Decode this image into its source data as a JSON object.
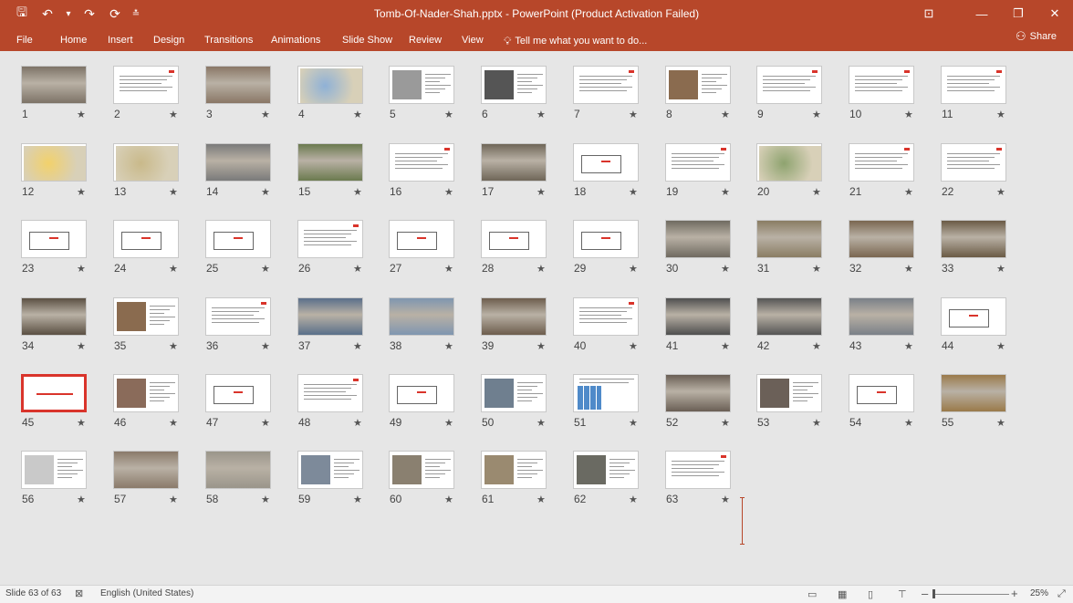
{
  "titlebar": {
    "title": "Tomb-Of-Nader-Shah.pptx - PowerPoint (Product Activation Failed)",
    "quick_access": [
      {
        "name": "save-icon",
        "glyph": "🖫"
      },
      {
        "name": "undo-icon",
        "glyph": "↶"
      },
      {
        "name": "undo-dropdown-icon",
        "glyph": "▾"
      },
      {
        "name": "redo-icon",
        "glyph": "↷"
      },
      {
        "name": "start-from-beginning-icon",
        "glyph": "⟳"
      },
      {
        "name": "customize-qat-icon",
        "glyph": "≛"
      }
    ],
    "window_controls": [
      {
        "name": "ribbon-display-options-icon",
        "glyph": "⊡"
      },
      {
        "name": "minimize-icon",
        "glyph": "—"
      },
      {
        "name": "restore-icon",
        "glyph": "❐"
      },
      {
        "name": "close-icon",
        "glyph": "✕"
      }
    ]
  },
  "ribbon": {
    "tabs": [
      "File",
      "Home",
      "Insert",
      "Design",
      "Transitions",
      "Animations",
      "Slide Show",
      "Review",
      "View"
    ],
    "tell_me": "Tell me what you want to do...",
    "tell_me_icon": "lightbulb-icon",
    "share": "Share",
    "share_icon": "person-icon"
  },
  "slides": {
    "count": 63,
    "transition_marker": "★",
    "selected": 63,
    "items": [
      {
        "n": "1",
        "kind": "photo",
        "tone": "#7d7367"
      },
      {
        "n": "2",
        "kind": "text",
        "tone": "#ffffff"
      },
      {
        "n": "3",
        "kind": "photo",
        "tone": "#8a7766"
      },
      {
        "n": "4",
        "kind": "map",
        "tone": "#8fb1d6"
      },
      {
        "n": "5",
        "kind": "photo-text",
        "tone": "#9a9a9a"
      },
      {
        "n": "6",
        "kind": "photo-text",
        "tone": "#555555"
      },
      {
        "n": "7",
        "kind": "text",
        "tone": "#ffffff"
      },
      {
        "n": "8",
        "kind": "photo-text",
        "tone": "#8a6b4f"
      },
      {
        "n": "9",
        "kind": "text",
        "tone": "#ffffff"
      },
      {
        "n": "10",
        "kind": "text",
        "tone": "#ffffff"
      },
      {
        "n": "11",
        "kind": "text",
        "tone": "#ffffff"
      },
      {
        "n": "12",
        "kind": "map",
        "tone": "#f2d16b"
      },
      {
        "n": "13",
        "kind": "map",
        "tone": "#c9b98a"
      },
      {
        "n": "14",
        "kind": "photo",
        "tone": "#7a7a7a"
      },
      {
        "n": "15",
        "kind": "photo",
        "tone": "#6b7a4f"
      },
      {
        "n": "16",
        "kind": "text",
        "tone": "#ffffff"
      },
      {
        "n": "17",
        "kind": "photo",
        "tone": "#6f6658"
      },
      {
        "n": "18",
        "kind": "drawing",
        "tone": "#ffffff"
      },
      {
        "n": "19",
        "kind": "text",
        "tone": "#ffffff"
      },
      {
        "n": "20",
        "kind": "map",
        "tone": "#8ea36f"
      },
      {
        "n": "21",
        "kind": "text",
        "tone": "#ffffff"
      },
      {
        "n": "22",
        "kind": "text",
        "tone": "#ffffff"
      },
      {
        "n": "23",
        "kind": "drawing",
        "tone": "#ffffff"
      },
      {
        "n": "24",
        "kind": "drawing",
        "tone": "#ffffff"
      },
      {
        "n": "25",
        "kind": "drawing",
        "tone": "#ffffff"
      },
      {
        "n": "26",
        "kind": "text",
        "tone": "#ffffff"
      },
      {
        "n": "27",
        "kind": "drawing",
        "tone": "#ffffff"
      },
      {
        "n": "28",
        "kind": "drawing",
        "tone": "#ffffff"
      },
      {
        "n": "29",
        "kind": "drawing",
        "tone": "#ffffff"
      },
      {
        "n": "30",
        "kind": "photo",
        "tone": "#6f6a60"
      },
      {
        "n": "31",
        "kind": "photo",
        "tone": "#8a7d63"
      },
      {
        "n": "32",
        "kind": "photo",
        "tone": "#7a6650"
      },
      {
        "n": "33",
        "kind": "photo",
        "tone": "#6a5a45"
      },
      {
        "n": "34",
        "kind": "photo",
        "tone": "#5b5043"
      },
      {
        "n": "35",
        "kind": "photo-text",
        "tone": "#8a6b4f"
      },
      {
        "n": "36",
        "kind": "text",
        "tone": "#ffffff"
      },
      {
        "n": "37",
        "kind": "photo",
        "tone": "#5a6f8a"
      },
      {
        "n": "38",
        "kind": "photo",
        "tone": "#7f96b0"
      },
      {
        "n": "39",
        "kind": "photo",
        "tone": "#6d5d4d"
      },
      {
        "n": "40",
        "kind": "text",
        "tone": "#ffffff"
      },
      {
        "n": "41",
        "kind": "photo",
        "tone": "#4f4f4f"
      },
      {
        "n": "42",
        "kind": "photo",
        "tone": "#555555"
      },
      {
        "n": "43",
        "kind": "photo",
        "tone": "#7a8088"
      },
      {
        "n": "44",
        "kind": "drawing",
        "tone": "#ffffff"
      },
      {
        "n": "45",
        "kind": "frame",
        "tone": "#ffffff"
      },
      {
        "n": "46",
        "kind": "photo-text",
        "tone": "#8a6b5a"
      },
      {
        "n": "47",
        "kind": "drawing",
        "tone": "#ffffff"
      },
      {
        "n": "48",
        "kind": "text",
        "tone": "#ffffff"
      },
      {
        "n": "49",
        "kind": "drawing",
        "tone": "#ffffff"
      },
      {
        "n": "50",
        "kind": "photo-text",
        "tone": "#6f7f8f"
      },
      {
        "n": "51",
        "kind": "grid",
        "tone": "#4f8ac9"
      },
      {
        "n": "52",
        "kind": "photo",
        "tone": "#6a5f55"
      },
      {
        "n": "53",
        "kind": "photo-text",
        "tone": "#6b6058"
      },
      {
        "n": "54",
        "kind": "drawing",
        "tone": "#ffffff"
      },
      {
        "n": "55",
        "kind": "photo",
        "tone": "#9a7a4a"
      },
      {
        "n": "56",
        "kind": "photo-text",
        "tone": "#c9c9c9"
      },
      {
        "n": "57",
        "kind": "photo",
        "tone": "#8a7a6a"
      },
      {
        "n": "58",
        "kind": "photo",
        "tone": "#9a958a"
      },
      {
        "n": "59",
        "kind": "photo-text",
        "tone": "#7d8a9a"
      },
      {
        "n": "60",
        "kind": "photo-text",
        "tone": "#8a8070"
      },
      {
        "n": "61",
        "kind": "photo-text",
        "tone": "#9a8a70"
      },
      {
        "n": "62",
        "kind": "photo-text",
        "tone": "#6a6a62"
      },
      {
        "n": "63",
        "kind": "text",
        "tone": "#ffffff"
      }
    ]
  },
  "statusbar": {
    "slide_info": "Slide 63 of 63",
    "notes_icon": "spell-check-icon",
    "language": "English (United States)",
    "zoom": "25%",
    "zoom_minus": "–",
    "zoom_plus": "+"
  },
  "colors": {
    "accent": "#b7472a",
    "background": "#e6e6e6",
    "statusbar": "#f3f3f3",
    "slide_red": "#d9342b"
  }
}
